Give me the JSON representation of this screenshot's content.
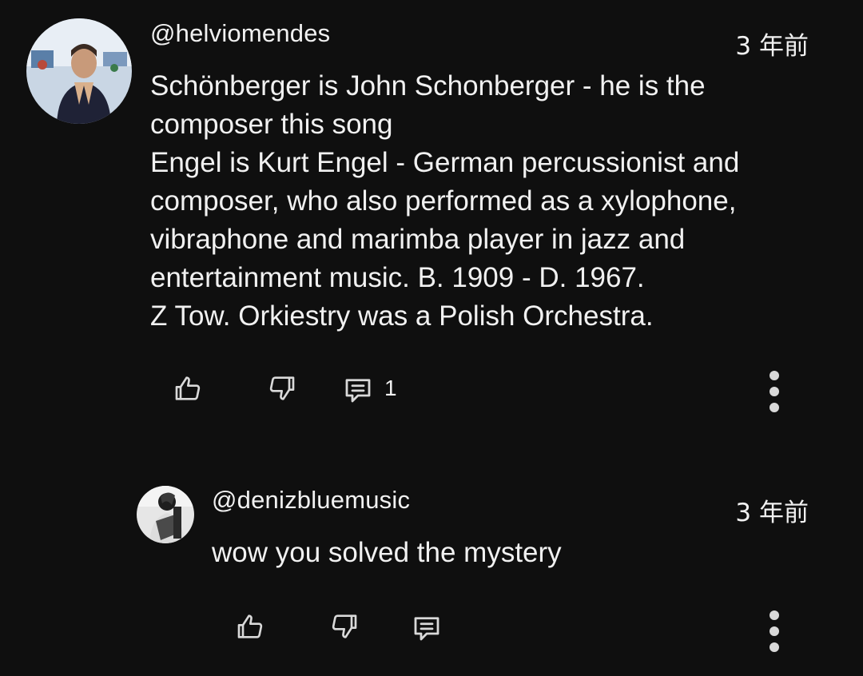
{
  "comments": [
    {
      "author": "@helviomendes",
      "time": "3 年前",
      "lines": [
        "Schönberger is John Schonberger - he is the",
        "composer this song",
        "Engel is Kurt Engel - German percussionist and",
        "composer, who also performed as a xylophone,",
        "vibraphone and marimba player in jazz and",
        "entertainment music. B. 1909 - D. 1967.",
        "Z Tow. Orkiestry was a Polish Orchestra."
      ],
      "reply_count": "1",
      "icons": [
        "like-icon",
        "dislike-icon",
        "reply-icon",
        "more-vert-icon"
      ]
    },
    {
      "author": "@denizbluemusic",
      "time": "3 年前",
      "lines": [
        "wow you solved the mystery"
      ],
      "reply_count": "",
      "icons": [
        "like-icon",
        "dislike-icon",
        "reply-icon",
        "more-vert-icon"
      ]
    }
  ],
  "colors": {
    "background": "#0f0f0f",
    "text": "#f1f1f1",
    "icon": "#d9d9d9"
  }
}
